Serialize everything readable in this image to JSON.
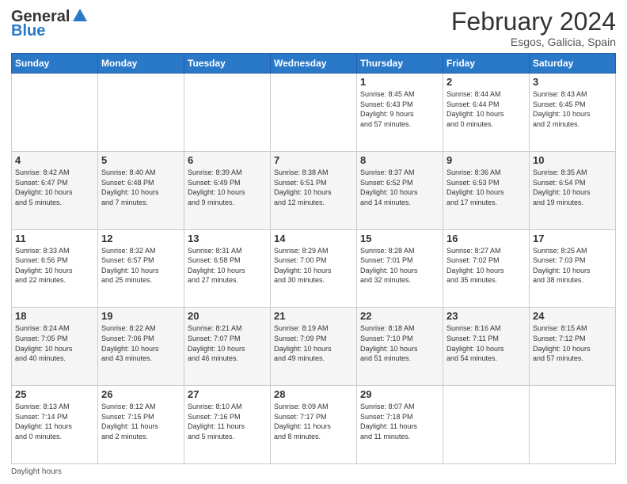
{
  "header": {
    "logo_general": "General",
    "logo_blue": "Blue",
    "month_title": "February 2024",
    "location": "Esgos, Galicia, Spain"
  },
  "weekdays": [
    "Sunday",
    "Monday",
    "Tuesday",
    "Wednesday",
    "Thursday",
    "Friday",
    "Saturday"
  ],
  "weeks": [
    [
      {
        "day": "",
        "info": ""
      },
      {
        "day": "",
        "info": ""
      },
      {
        "day": "",
        "info": ""
      },
      {
        "day": "",
        "info": ""
      },
      {
        "day": "1",
        "info": "Sunrise: 8:45 AM\nSunset: 6:43 PM\nDaylight: 9 hours\nand 57 minutes."
      },
      {
        "day": "2",
        "info": "Sunrise: 8:44 AM\nSunset: 6:44 PM\nDaylight: 10 hours\nand 0 minutes."
      },
      {
        "day": "3",
        "info": "Sunrise: 8:43 AM\nSunset: 6:45 PM\nDaylight: 10 hours\nand 2 minutes."
      }
    ],
    [
      {
        "day": "4",
        "info": "Sunrise: 8:42 AM\nSunset: 6:47 PM\nDaylight: 10 hours\nand 5 minutes."
      },
      {
        "day": "5",
        "info": "Sunrise: 8:40 AM\nSunset: 6:48 PM\nDaylight: 10 hours\nand 7 minutes."
      },
      {
        "day": "6",
        "info": "Sunrise: 8:39 AM\nSunset: 6:49 PM\nDaylight: 10 hours\nand 9 minutes."
      },
      {
        "day": "7",
        "info": "Sunrise: 8:38 AM\nSunset: 6:51 PM\nDaylight: 10 hours\nand 12 minutes."
      },
      {
        "day": "8",
        "info": "Sunrise: 8:37 AM\nSunset: 6:52 PM\nDaylight: 10 hours\nand 14 minutes."
      },
      {
        "day": "9",
        "info": "Sunrise: 8:36 AM\nSunset: 6:53 PM\nDaylight: 10 hours\nand 17 minutes."
      },
      {
        "day": "10",
        "info": "Sunrise: 8:35 AM\nSunset: 6:54 PM\nDaylight: 10 hours\nand 19 minutes."
      }
    ],
    [
      {
        "day": "11",
        "info": "Sunrise: 8:33 AM\nSunset: 6:56 PM\nDaylight: 10 hours\nand 22 minutes."
      },
      {
        "day": "12",
        "info": "Sunrise: 8:32 AM\nSunset: 6:57 PM\nDaylight: 10 hours\nand 25 minutes."
      },
      {
        "day": "13",
        "info": "Sunrise: 8:31 AM\nSunset: 6:58 PM\nDaylight: 10 hours\nand 27 minutes."
      },
      {
        "day": "14",
        "info": "Sunrise: 8:29 AM\nSunset: 7:00 PM\nDaylight: 10 hours\nand 30 minutes."
      },
      {
        "day": "15",
        "info": "Sunrise: 8:28 AM\nSunset: 7:01 PM\nDaylight: 10 hours\nand 32 minutes."
      },
      {
        "day": "16",
        "info": "Sunrise: 8:27 AM\nSunset: 7:02 PM\nDaylight: 10 hours\nand 35 minutes."
      },
      {
        "day": "17",
        "info": "Sunrise: 8:25 AM\nSunset: 7:03 PM\nDaylight: 10 hours\nand 38 minutes."
      }
    ],
    [
      {
        "day": "18",
        "info": "Sunrise: 8:24 AM\nSunset: 7:05 PM\nDaylight: 10 hours\nand 40 minutes."
      },
      {
        "day": "19",
        "info": "Sunrise: 8:22 AM\nSunset: 7:06 PM\nDaylight: 10 hours\nand 43 minutes."
      },
      {
        "day": "20",
        "info": "Sunrise: 8:21 AM\nSunset: 7:07 PM\nDaylight: 10 hours\nand 46 minutes."
      },
      {
        "day": "21",
        "info": "Sunrise: 8:19 AM\nSunset: 7:09 PM\nDaylight: 10 hours\nand 49 minutes."
      },
      {
        "day": "22",
        "info": "Sunrise: 8:18 AM\nSunset: 7:10 PM\nDaylight: 10 hours\nand 51 minutes."
      },
      {
        "day": "23",
        "info": "Sunrise: 8:16 AM\nSunset: 7:11 PM\nDaylight: 10 hours\nand 54 minutes."
      },
      {
        "day": "24",
        "info": "Sunrise: 8:15 AM\nSunset: 7:12 PM\nDaylight: 10 hours\nand 57 minutes."
      }
    ],
    [
      {
        "day": "25",
        "info": "Sunrise: 8:13 AM\nSunset: 7:14 PM\nDaylight: 11 hours\nand 0 minutes."
      },
      {
        "day": "26",
        "info": "Sunrise: 8:12 AM\nSunset: 7:15 PM\nDaylight: 11 hours\nand 2 minutes."
      },
      {
        "day": "27",
        "info": "Sunrise: 8:10 AM\nSunset: 7:16 PM\nDaylight: 11 hours\nand 5 minutes."
      },
      {
        "day": "28",
        "info": "Sunrise: 8:09 AM\nSunset: 7:17 PM\nDaylight: 11 hours\nand 8 minutes."
      },
      {
        "day": "29",
        "info": "Sunrise: 8:07 AM\nSunset: 7:18 PM\nDaylight: 11 hours\nand 11 minutes."
      },
      {
        "day": "",
        "info": ""
      },
      {
        "day": "",
        "info": ""
      }
    ]
  ],
  "footer": {
    "note": "Daylight hours"
  }
}
